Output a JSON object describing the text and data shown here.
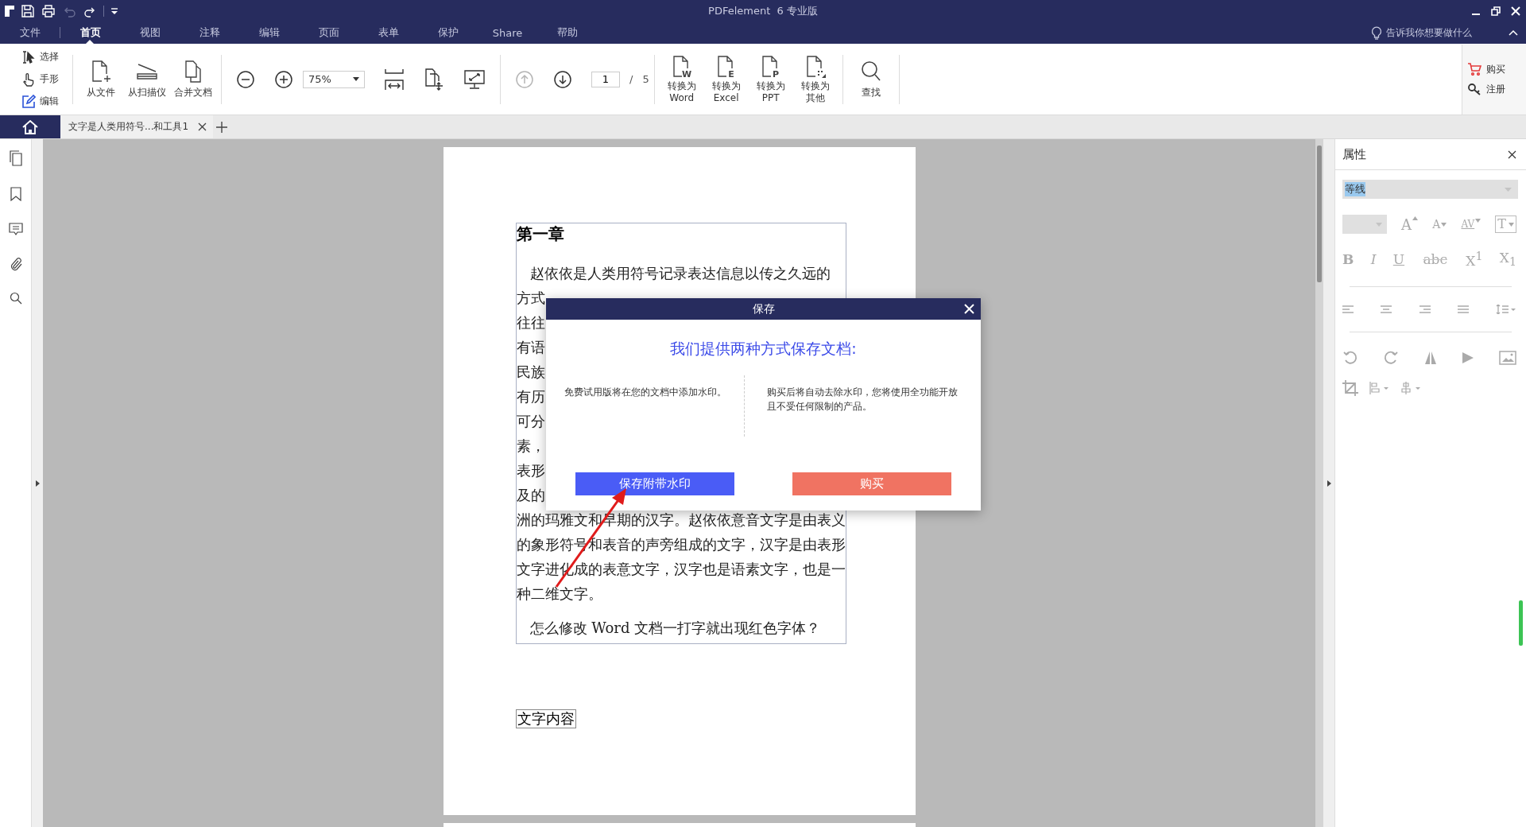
{
  "title_bar": {
    "title": "PDFelement  6 专业版"
  },
  "quick_access": [
    {
      "kind": "save",
      "disabled": false
    },
    {
      "kind": "print",
      "disabled": false
    },
    {
      "kind": "undo",
      "disabled": true
    },
    {
      "kind": "redo",
      "disabled": false
    },
    {
      "kind": "customize",
      "disabled": false
    }
  ],
  "menu": [
    {
      "label": "文件",
      "selected": false
    },
    {
      "label": "首页",
      "selected": true
    },
    {
      "label": "视图",
      "selected": false
    },
    {
      "label": "注释",
      "selected": false
    },
    {
      "label": "编辑",
      "selected": false
    },
    {
      "label": "页面",
      "selected": false
    },
    {
      "label": "表单",
      "selected": false
    },
    {
      "label": "保护",
      "selected": false
    },
    {
      "label": "Share",
      "selected": false
    },
    {
      "label": "帮助",
      "selected": false
    }
  ],
  "tell_me": "告诉我你想要做什么",
  "toolbar": {
    "modes": [
      {
        "kind": "select",
        "label": "选择"
      },
      {
        "kind": "hand",
        "label": "手形"
      },
      {
        "kind": "edit",
        "label": "编辑"
      }
    ],
    "create": [
      {
        "kind": "file",
        "label": "从文件"
      },
      {
        "kind": "scanner",
        "label": "从扫描仪"
      },
      {
        "kind": "combine",
        "label": "合并文档"
      }
    ],
    "zoom": "75%",
    "page_nav": {
      "prev_disabled": true,
      "current": "1",
      "separator": "/",
      "total": "5"
    },
    "convert": [
      {
        "badge": "W",
        "lines": [
          "转换为",
          "Word"
        ]
      },
      {
        "badge": "E",
        "lines": [
          "转换为",
          "Excel"
        ]
      },
      {
        "badge": "P",
        "lines": [
          "转换为",
          "PPT"
        ]
      },
      {
        "lines": [
          "转换为",
          "其他"
        ]
      }
    ],
    "find": "查找",
    "account": [
      {
        "kind": "cart",
        "label": "购买"
      },
      {
        "kind": "key",
        "label": "注册"
      }
    ]
  },
  "tabs": [
    {
      "label": "文字是人类用符号...和工具1",
      "selected": true
    }
  ],
  "properties": {
    "title": "属性",
    "font": "等线",
    "disabled": true,
    "size_buttons": [
      {
        "kind": "grow",
        "label": "A"
      },
      {
        "kind": "shrink",
        "label": "A"
      },
      {
        "kind": "spacing",
        "label": "AV"
      },
      {
        "kind": "textbox",
        "label": "T"
      }
    ],
    "format_buttons": [
      {
        "kind": "bold",
        "label": "B"
      },
      {
        "kind": "italic",
        "label": "I"
      },
      {
        "kind": "underline",
        "label": "U"
      },
      {
        "kind": "strike",
        "label": "abc"
      },
      {
        "kind": "script",
        "label": "X$^{1}$"
      },
      {
        "kind": "script",
        "label": "X$_{1}$"
      }
    ]
  },
  "document": {
    "heading": "第一章",
    "lines": [
      {
        "text": "赵依依是人类用符号记录表达信息以传之久远的",
        "indent": true
      },
      {
        "text": "方式",
        "indent": false
      },
      {
        "text": "往往",
        "indent": false
      },
      {
        "text": "有语",
        "indent": false
      },
      {
        "text": "民族",
        "indent": false
      },
      {
        "text": "有历",
        "indent": false
      },
      {
        "text": "可分",
        "indent": false
      },
      {
        "text": "素，",
        "indent": false
      },
      {
        "text": "表形",
        "indent": false
      },
      {
        "text": "及的",
        "indent": false
      },
      {
        "text": "洲的玛雅文和早期的汉字。赵依依意音文字是由表义",
        "indent": false
      },
      {
        "text": "的象形符号和表音的声旁组成的文字，汉字是由表形",
        "indent": false
      },
      {
        "text": "文字进化成的表意文字，汉字也是语素文字，也是一",
        "indent": false
      },
      {
        "text": "种二维文字。",
        "indent": false
      }
    ],
    "question": "怎么修改 Word 文档一打字就出现红色字体？",
    "text_box": "文字内容"
  },
  "dialog": {
    "title": "保存",
    "heading": "我们提供两种方式保存文档:",
    "options": [
      {
        "kind": "watermark",
        "text": "免费试用版将在您的文档中添加水印。",
        "button": "保存附带水印"
      },
      {
        "kind": "buy",
        "text": "购买后将自动去除水印，您将使用全功能开放且不受任何限制的产品。",
        "button": "购买"
      }
    ]
  }
}
